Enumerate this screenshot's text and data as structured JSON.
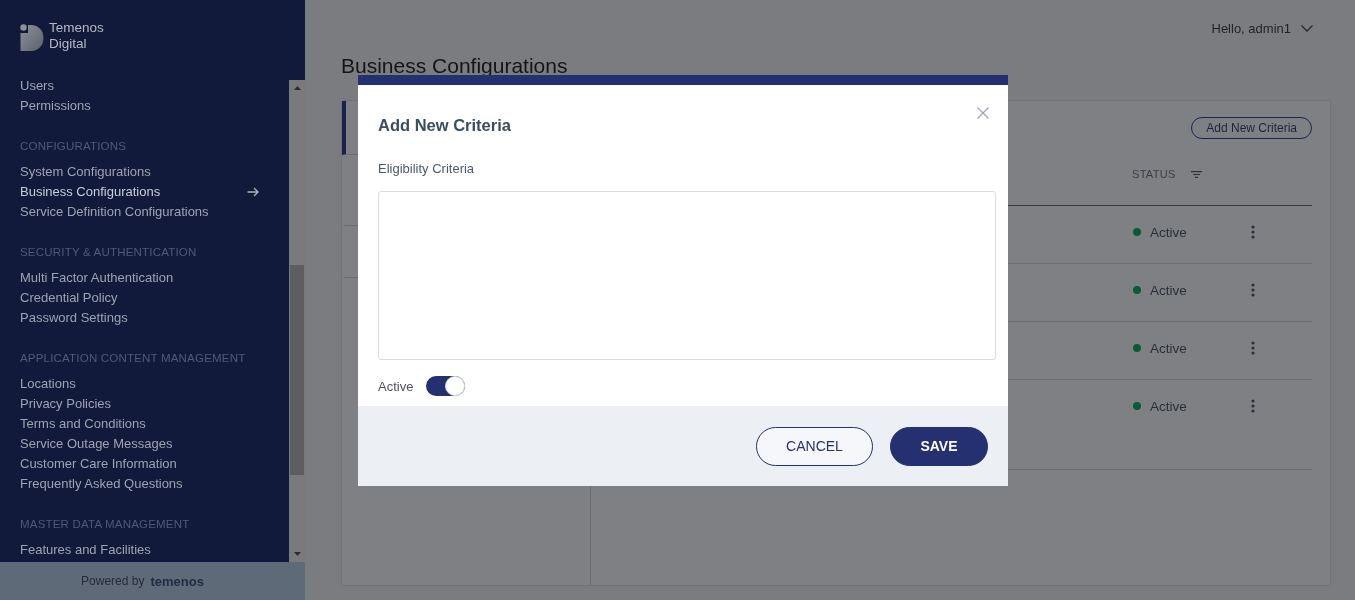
{
  "sidebar": {
    "brand": {
      "line_1": "Temenos",
      "line_2": "Digital"
    },
    "groups": [
      {
        "items": [
          {
            "label": "Users",
            "selected": false
          },
          {
            "label": "Permissions",
            "selected": false
          }
        ]
      },
      {
        "heading": "CONFIGURATIONS",
        "items": [
          {
            "label": "System Configurations",
            "selected": false
          },
          {
            "label": "Business Configurations",
            "selected": true
          },
          {
            "label": "Service Definition Configurations",
            "selected": false
          }
        ]
      },
      {
        "heading": "SECURITY & AUTHENTICATION",
        "items": [
          {
            "label": "Multi Factor Authentication",
            "selected": false
          },
          {
            "label": "Credential Policy",
            "selected": false
          },
          {
            "label": "Password Settings",
            "selected": false
          }
        ]
      },
      {
        "heading": "APPLICATION CONTENT MANAGEMENT",
        "items": [
          {
            "label": "Locations",
            "selected": false
          },
          {
            "label": "Privacy Policies",
            "selected": false
          },
          {
            "label": "Terms and Conditions",
            "selected": false
          },
          {
            "label": "Service Outage Messages",
            "selected": false
          },
          {
            "label": "Customer Care Information",
            "selected": false
          },
          {
            "label": "Frequently Asked Questions",
            "selected": false
          }
        ]
      },
      {
        "heading": "MASTER DATA MANAGEMENT",
        "items": [
          {
            "label": "Features and Facilities",
            "selected": false
          }
        ]
      }
    ],
    "footer": {
      "prefix": "Powered by",
      "brand": "temenos"
    }
  },
  "header": {
    "greeting": "Hello, admin1"
  },
  "page_title": "Business Configurations",
  "category_list": [
    {
      "selected": true
    },
    {
      "selected": false
    },
    {
      "selected": false
    }
  ],
  "criteria_table": {
    "add_button": "Add New Criteria",
    "columns": [
      "STATUS"
    ],
    "rows": [
      {
        "status": "Active"
      },
      {
        "status": "Active"
      },
      {
        "status": "Active"
      },
      {
        "status": "Active"
      }
    ]
  },
  "modal": {
    "title": "Add New Criteria",
    "field_label": "Eligibility Criteria",
    "toggle_label": "Active",
    "active_on": true,
    "buttons": [
      {
        "label": "CANCEL",
        "kind": "secondary"
      },
      {
        "label": "SAVE",
        "kind": "primary"
      }
    ]
  }
}
